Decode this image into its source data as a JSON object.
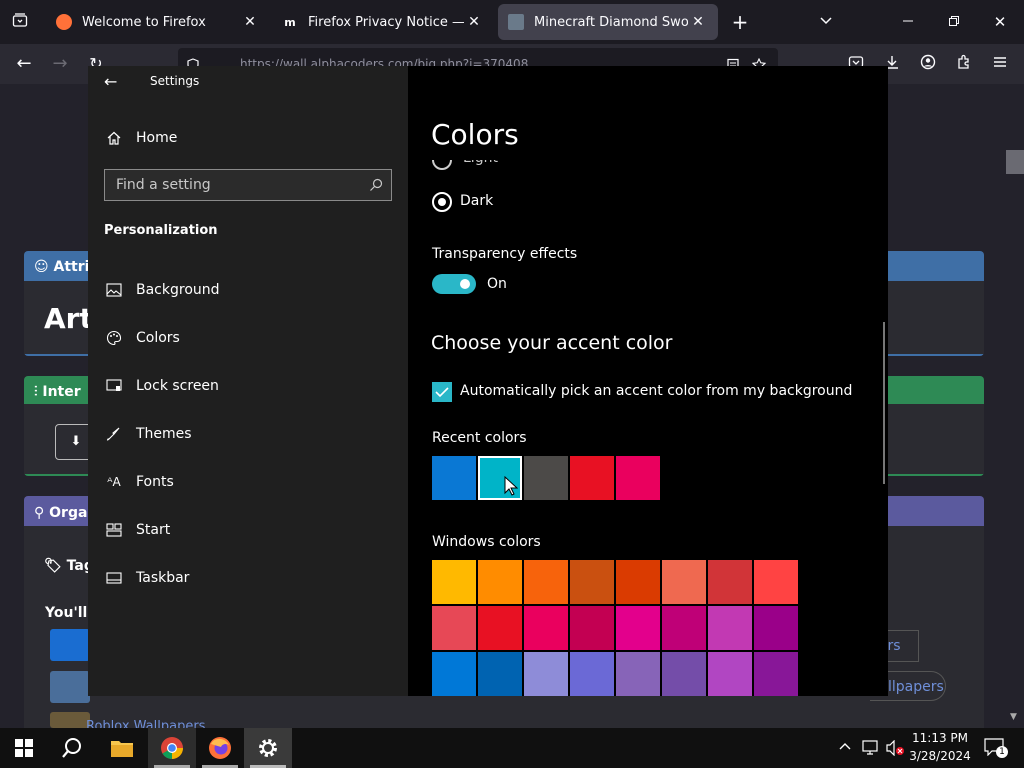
{
  "browser": {
    "tabs": [
      {
        "title": "Welcome to Firefox"
      },
      {
        "title": "Firefox Privacy Notice — Mozill"
      },
      {
        "title": "Minecraft Diamond Sword by m"
      }
    ],
    "url": "https://wall.alphacoders.com/big.php?i=370408"
  },
  "page_behind": {
    "card1_title": "Attril",
    "card1_big": "Arti",
    "card2_title": "Inter",
    "card3_title": "Orga",
    "tags_label": "Tag",
    "youll_label": "You'll",
    "pill_papers": "pers",
    "pill_llpapers": "llpapers",
    "link_roblox": "Roblox Wallpapers"
  },
  "settings": {
    "window_title": "Settings",
    "home_label": "Home",
    "search_placeholder": "Find a setting",
    "section_label": "Personalization",
    "nav": [
      {
        "label": "Background",
        "icon": "picture-icon"
      },
      {
        "label": "Colors",
        "icon": "palette-icon"
      },
      {
        "label": "Lock screen",
        "icon": "lock-screen-icon"
      },
      {
        "label": "Themes",
        "icon": "themes-icon"
      },
      {
        "label": "Fonts",
        "icon": "fonts-icon"
      },
      {
        "label": "Start",
        "icon": "start-icon"
      },
      {
        "label": "Taskbar",
        "icon": "taskbar-icon"
      }
    ],
    "page_title": "Colors",
    "mode_light": "Light",
    "mode_dark": "Dark",
    "transparency_label": "Transparency effects",
    "transparency_state": "On",
    "accent_heading": "Choose your accent color",
    "auto_pick_label": "Automatically pick an accent color from my background",
    "recent_label": "Recent colors",
    "recent_colors": [
      "#0a78d4",
      "#00b4c8",
      "#4c4a48",
      "#e81123",
      "#ea005e"
    ],
    "windows_label": "Windows colors",
    "windows_colors": [
      [
        "#ffb900",
        "#ff8c00",
        "#f7630c",
        "#ca5010",
        "#da3b01",
        "#ef6950",
        "#d13438",
        "#ff4343"
      ],
      [
        "#e74856",
        "#e81123",
        "#ea005e",
        "#c30052",
        "#e3008c",
        "#bf0077",
        "#c239b3",
        "#9a0089"
      ],
      [
        "#0078d7",
        "#0063b1",
        "#8e8cd8",
        "#6b69d6",
        "#8764b8",
        "#744da9",
        "#b146c2",
        "#881798"
      ]
    ]
  },
  "taskbar": {
    "time": "11:13 PM",
    "date": "3/28/2024",
    "notification_count": "1"
  },
  "colors": {
    "accent": "#2ab7c8",
    "settings_bg": "#000000",
    "sidebar_bg": "#1f1f1f"
  }
}
